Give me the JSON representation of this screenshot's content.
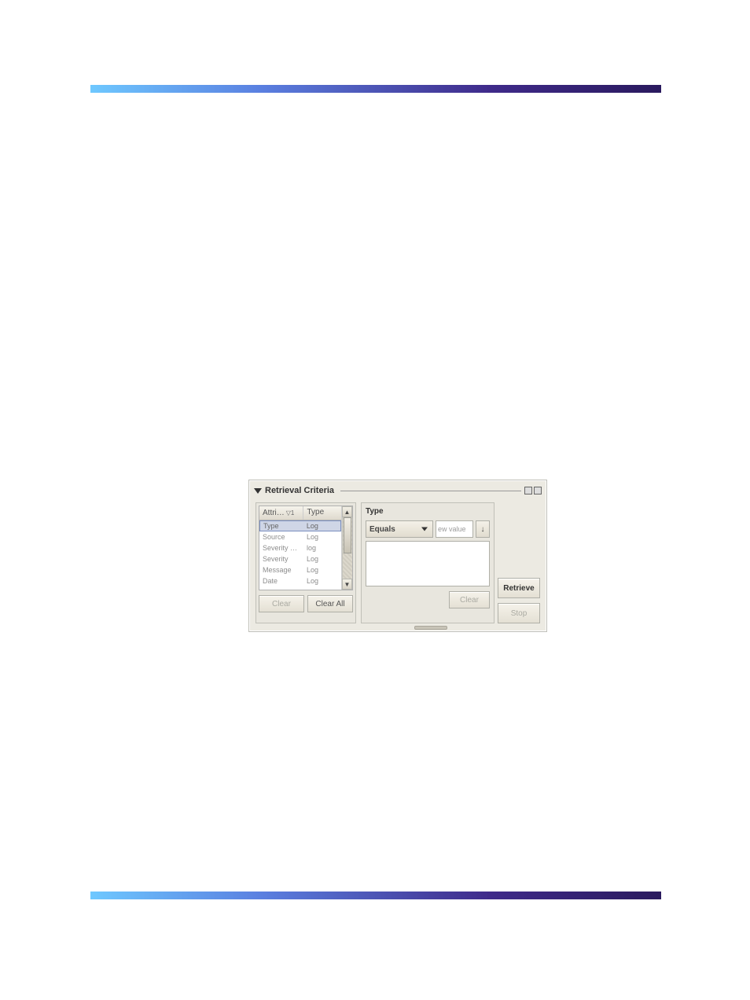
{
  "panel": {
    "title": "Retrieval Criteria"
  },
  "attr_table": {
    "head_a": "Attri…",
    "sort": "▽1",
    "head_b": "Type",
    "rows": [
      {
        "a": "Type",
        "b": "Log"
      },
      {
        "a": "Source",
        "b": "Log"
      },
      {
        "a": "Severity …",
        "b": "log"
      },
      {
        "a": "Severity",
        "b": "Log"
      },
      {
        "a": "Message",
        "b": "Log"
      },
      {
        "a": "Date",
        "b": "Log"
      }
    ]
  },
  "left_buttons": {
    "clear": "Clear",
    "clear_all": "Clear All"
  },
  "mid": {
    "title": "Type",
    "combo": "Equals",
    "value_placeholder": "ew value",
    "clear": "Clear"
  },
  "right_buttons": {
    "retrieve": "Retrieve",
    "stop": "Stop"
  }
}
